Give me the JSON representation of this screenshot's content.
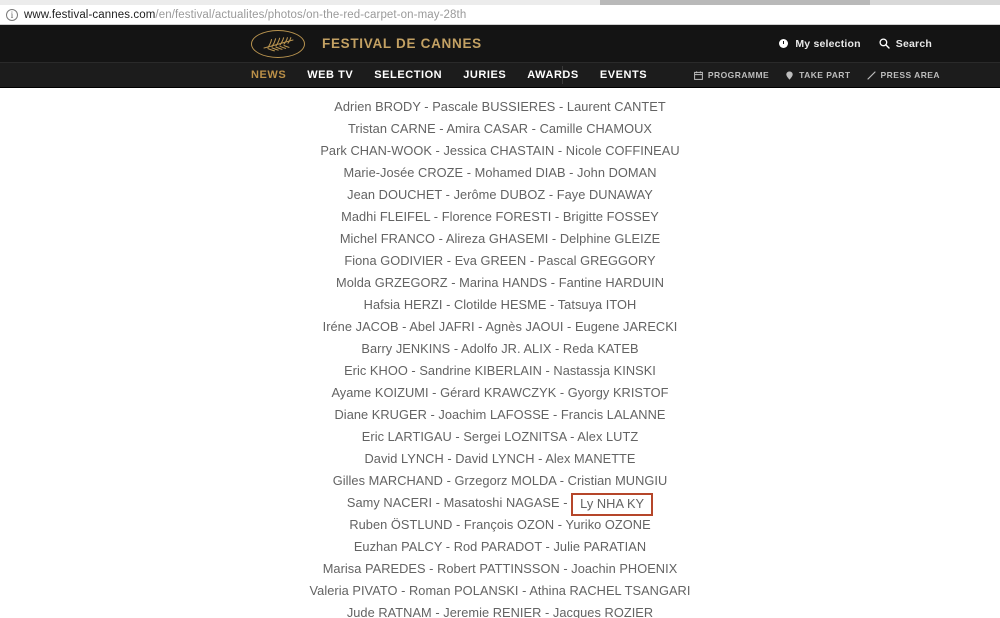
{
  "browser": {
    "info_icon": "info-icon",
    "url_host": "www.festival-cannes.com",
    "url_path": "/en/festival/actualites/photos/on-the-red-carpet-on-may-28th"
  },
  "header": {
    "logo_alt": "palm-leaf-logo",
    "brand_title": "FESTIVAL DE CANNES",
    "utils": [
      {
        "icon": "clock-icon",
        "label": "My selection"
      },
      {
        "icon": "search-icon",
        "label": "Search"
      }
    ]
  },
  "nav": {
    "main": [
      {
        "label": "NEWS",
        "active": true
      },
      {
        "label": "WEB TV",
        "active": false
      },
      {
        "label": "SELECTION",
        "active": false
      },
      {
        "label": "JURIES",
        "active": false
      },
      {
        "label": "AWARDS",
        "active": false
      },
      {
        "label": "EVENTS",
        "active": false
      }
    ],
    "secondary": [
      {
        "icon": "calendar-icon",
        "label": "PROGRAMME"
      },
      {
        "icon": "pin-icon",
        "label": "TAKE PART"
      },
      {
        "icon": "pen-icon",
        "label": "PRESS AREA"
      }
    ]
  },
  "content": {
    "rows": [
      {
        "text": "Adrien BRODY - Pascale BUSSIERES - Laurent CANTET"
      },
      {
        "text": "Tristan CARNE - Amira CASAR - Camille CHAMOUX"
      },
      {
        "text": "Park CHAN-WOOK - Jessica CHASTAIN - Nicole COFFINEAU"
      },
      {
        "text": "Marie-Josée CROZE - Mohamed DIAB - John DOMAN"
      },
      {
        "text": "Jean DOUCHET - Jerôme DUBOZ - Faye DUNAWAY"
      },
      {
        "text": "Madhi FLEIFEL - Florence FORESTI - Brigitte FOSSEY"
      },
      {
        "text": "Michel FRANCO - Alireza GHASEMI - Delphine GLEIZE"
      },
      {
        "text": "Fiona GODIVIER - Eva GREEN - Pascal GREGGORY"
      },
      {
        "text": "Molda GRZEGORZ - Marina HANDS - Fantine HARDUIN"
      },
      {
        "text": "Hafsia HERZI - Clotilde HESME - Tatsuya ITOH"
      },
      {
        "text": "Iréne JACOB - Abel JAFRI - Agnès JAOUI - Eugene JARECKI"
      },
      {
        "text": "Barry JENKINS - Adolfo JR. ALIX - Reda KATEB"
      },
      {
        "text": "Eric KHOO - Sandrine KIBERLAIN - Nastassja KINSKI"
      },
      {
        "text": "Ayame KOIZUMI - Gérard KRAWCZYK - Gyorgy KRISTOF"
      },
      {
        "text": "Diane KRUGER - Joachim LAFOSSE - Francis LALANNE"
      },
      {
        "text": "Eric LARTIGAU - Sergei LOZNITSA - Alex LUTZ"
      },
      {
        "text": "David LYNCH - David LYNCH - Alex MANETTE"
      },
      {
        "text": "Gilles MARCHAND - Grzegorz MOLDA - Cristian MUNGIU"
      },
      {
        "text": "Samy NACERI - Masatoshi NAGASE - ",
        "highlight": "Ly NHA KY"
      },
      {
        "text": "Ruben ÖSTLUND - François OZON - Yuriko OZONE"
      },
      {
        "text": "Euzhan PALCY - Rod PARADOT - Julie PARATIAN"
      },
      {
        "text": "Marisa PAREDES - Robert PATTINSSON - Joachin PHOENIX"
      },
      {
        "text": "Valeria PIVATO - Roman POLANSKI - Athina RACHEL TSANGARI"
      },
      {
        "text": "Jude RATNAM - Jeremie RENIER - Jacques ROZIER"
      }
    ],
    "highlight_color": "#b5462a"
  },
  "colors": {
    "gold": "#c3a163",
    "nav_active": "#bb9048",
    "header_bg": "#141414",
    "nav_bg": "#1c1c1c",
    "text_gray": "#636363"
  }
}
